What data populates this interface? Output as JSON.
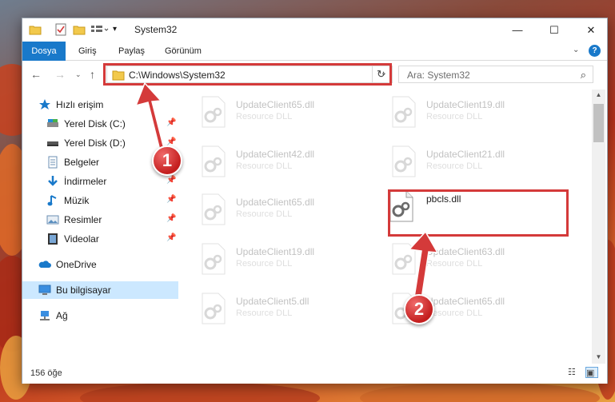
{
  "window": {
    "title": "System32",
    "controls": {
      "minimize": "—",
      "maximize": "☐",
      "close": "✕"
    }
  },
  "ribbon": {
    "tabs": [
      "Dosya",
      "Giriş",
      "Paylaş",
      "Görünüm"
    ],
    "help_icon": "?"
  },
  "address": {
    "path": "C:\\Windows\\System32",
    "search_placeholder": "Ara: System32"
  },
  "sidebar": {
    "items": [
      {
        "label": "Hızlı erişim",
        "icon": "star-icon",
        "pinned": false
      },
      {
        "label": "Yerel Disk (C:)",
        "icon": "drive-icon",
        "pinned": true
      },
      {
        "label": "Yerel Disk (D:)",
        "icon": "drive-icon",
        "pinned": true
      },
      {
        "label": "Belgeler",
        "icon": "documents-icon",
        "pinned": true
      },
      {
        "label": "İndirmeler",
        "icon": "download-icon",
        "pinned": true
      },
      {
        "label": "Müzik",
        "icon": "music-icon",
        "pinned": true
      },
      {
        "label": "Resimler",
        "icon": "pictures-icon",
        "pinned": true
      },
      {
        "label": "Videolar",
        "icon": "videos-icon",
        "pinned": true
      },
      {
        "label": "OneDrive",
        "icon": "cloud-icon",
        "pinned": false
      },
      {
        "label": "Bu bilgisayar",
        "icon": "computer-icon",
        "pinned": false
      },
      {
        "label": "Ağ",
        "icon": "network-icon",
        "pinned": false
      }
    ]
  },
  "files": [
    {
      "name": "UpdateClient65.dll",
      "desc": "Resource DLL"
    },
    {
      "name": "UpdateClient19.dll",
      "desc": "Resource DLL"
    },
    {
      "name": "UpdateClient42.dll",
      "desc": "Resource DLL"
    },
    {
      "name": "UpdateClient21.dll",
      "desc": "Resource DLL"
    },
    {
      "name": "UpdateClient65.dll",
      "desc": "Resource DLL"
    },
    {
      "name": "pbcls.dll",
      "desc": ""
    },
    {
      "name": "UpdateClient19.dll",
      "desc": "Resource DLL"
    },
    {
      "name": "UpdateClient63.dll",
      "desc": "Resource DLL"
    },
    {
      "name": "UpdateClient5.dll",
      "desc": "Resource DLL"
    },
    {
      "name": "UpdateClient65.dll",
      "desc": "Resource DLL"
    }
  ],
  "status": {
    "count": "156 öğe"
  },
  "annotations": {
    "step1": "1",
    "step2": "2"
  },
  "colors": {
    "accent": "#1979ca",
    "highlight": "#d43a3a",
    "selected": "#cce8ff"
  }
}
